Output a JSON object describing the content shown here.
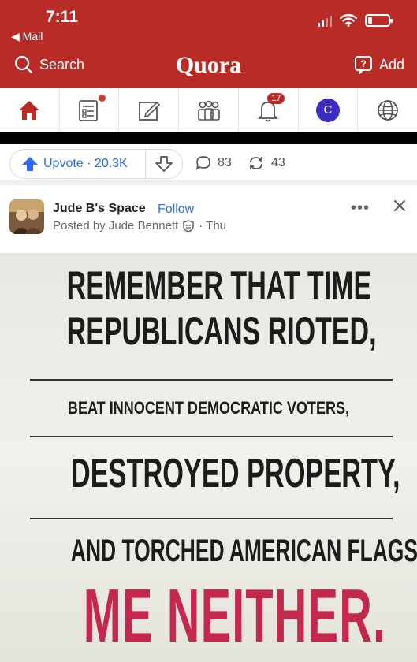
{
  "status_bar": {
    "time": "7:11",
    "back_label": "◀ Mail"
  },
  "header": {
    "search_label": "Search",
    "logo": "Quora",
    "add_label": "Add",
    "color": "#b92b27"
  },
  "nav": {
    "tabs": [
      {
        "name": "home",
        "icon": "home-icon",
        "active": true
      },
      {
        "name": "following",
        "icon": "feed-icon",
        "has_dot": true
      },
      {
        "name": "answer",
        "icon": "edit-icon"
      },
      {
        "name": "spaces",
        "icon": "people-icon"
      },
      {
        "name": "notifications",
        "icon": "bell-icon",
        "badge": "17"
      },
      {
        "name": "profile",
        "icon": "avatar",
        "avatar_letter": "C"
      },
      {
        "name": "languages",
        "icon": "globe-icon"
      }
    ]
  },
  "actions": {
    "upvote_label": "Upvote · 20.3K",
    "comments": "83",
    "shares": "43",
    "accent": "#2e69ff"
  },
  "post": {
    "space_name": "Jude B's Space",
    "follow_label": "Follow",
    "posted_by": "Posted by Jude Bennett",
    "time": "· Thu"
  },
  "meme": {
    "line1": "REMEMBER THAT TIME",
    "line2": "REPUBLICANS RIOTED,",
    "line3": "BEAT INNOCENT DEMOCRATIC VOTERS,",
    "line4": "DESTROYED PROPERTY,",
    "line5": "AND TORCHED AMERICAN FLAGS?",
    "line6": "ME NEITHER.",
    "highlight_color": "#c2294d"
  }
}
